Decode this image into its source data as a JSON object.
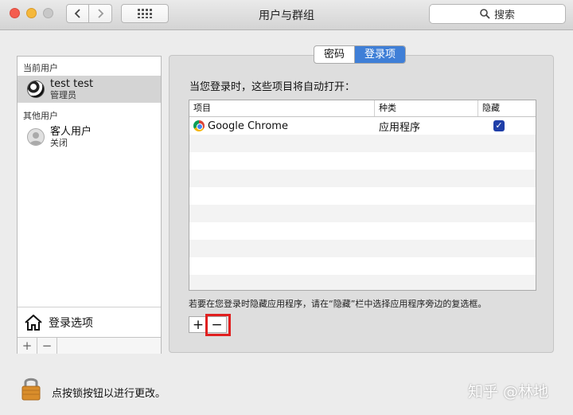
{
  "window": {
    "title": "用户与群组",
    "search_label": "搜索"
  },
  "sidebar": {
    "current_users_header": "当前用户",
    "other_users_header": "其他用户",
    "users": [
      {
        "name": "test test",
        "role": "管理员",
        "avatar": "soccer-ball-icon",
        "selected": true
      },
      {
        "name": "客人用户",
        "role": "关闭",
        "avatar": "guest-user-icon",
        "selected": false
      }
    ],
    "login_options_label": "登录选项",
    "footer_buttons": [
      "+",
      "−"
    ]
  },
  "tabs": [
    {
      "label": "密码",
      "active": false
    },
    {
      "label": "登录项",
      "active": true
    }
  ],
  "login_items": {
    "description": "当您登录时，这些项目将自动打开：",
    "columns": [
      "项目",
      "种类",
      "隐藏"
    ],
    "rows": [
      {
        "item": "Google Chrome",
        "kind": "应用程序",
        "hidden": true
      }
    ],
    "hint": "若要在您登录时隐藏应用程序，请在“隐藏”栏中选择应用程序旁边的复选框。",
    "add_button": "+",
    "remove_button": "−"
  },
  "footer": {
    "lock_text": "点按锁按钮以进行更改。",
    "watermark": "知乎 @林地"
  },
  "colors": {
    "accent": "#3f7fd7",
    "highlight": "#e02020",
    "checkbox": "#1f3ea8"
  }
}
